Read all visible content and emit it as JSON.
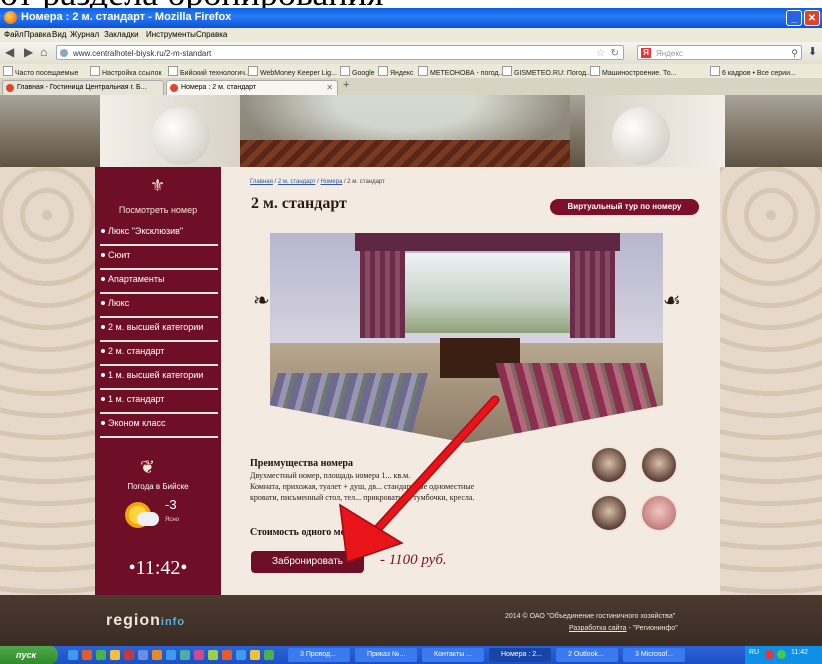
{
  "window": {
    "title": "Номера : 2 м. стандарт - Mozilla Firefox"
  },
  "menu": [
    "Файл",
    "Правка",
    "Вид",
    "Журнал",
    "Закладки",
    "Инструменты",
    "Справка"
  ],
  "url": "www.centralhotel-biysk.ru/2-m-standart",
  "search": {
    "placeholder": "Яндекс"
  },
  "bookmarks": [
    "Часто посещаемые",
    "Настройка ссылок",
    "Бийский технологич...",
    "WebMoney Keeper Lig...",
    "Google",
    "Яндекс",
    "МЕТЕОНОВА - погод...",
    "GISMETEO.RU: Погод...",
    "Машиностроение. То...",
    "6 кадров • Все серии..."
  ],
  "tabs": [
    {
      "label": "Главная - Гостиница Центральная г. Б..."
    },
    {
      "label": "Номера : 2 м. стандарт"
    }
  ],
  "sidebar": {
    "title": "Посмотреть номер",
    "items": [
      "Люкс \"Эксклюзив\"",
      "Сюит",
      "Апартаменты",
      "Люкс",
      "2 м. высшей категории",
      "2 м. стандарт",
      "1 м. высшей категории",
      "1 м. стандарт",
      "Эконом класс"
    ],
    "weather_title": "Погода в Бийске",
    "temp": "-3",
    "condition": "Ясно",
    "clock": "11:42"
  },
  "breadcrumb": {
    "items": [
      "Главная",
      "2 м. стандарт",
      "Номера"
    ],
    "current": "2 м. стандарт",
    "sep": " / "
  },
  "page": {
    "title": "2 м. стандарт",
    "virtual_tour": "Виртуальный тур по номеру",
    "advantages_title": "Преимущества номера",
    "advantages_lines": [
      "Двухместный номер, площадь номера 1... кв.м.",
      "Комната, прихожая, туалет + душ, дв... стандартные одноместные",
      "кровати, письменный стол, тел... прикроватные тумбочки, кресла."
    ],
    "price_label": "Стоимость одного места",
    "book_button": "Забронировать",
    "price": "- 1100 руб."
  },
  "footer": {
    "logo_main": "region",
    "logo_sub": "info",
    "copyright": "2014 © ОАО \"Объединение гостиничного хозяйства\"",
    "dev_link": "Разработка сайта",
    "dev_name": " - \"Регионинфо\""
  },
  "taskbar": {
    "start": "пуск",
    "tasks": [
      "3 Провод...",
      "Приказ №...",
      "Контакты ...",
      "Номера : 2...",
      "2 Outlook...",
      "3 Microsof..."
    ],
    "lang": "RU",
    "clock": "11:42"
  },
  "colors": {
    "sidebar": "#6e0f27",
    "button": "#6d0f26",
    "price": "#7d0f2a",
    "arrow": "#e8141a"
  }
}
